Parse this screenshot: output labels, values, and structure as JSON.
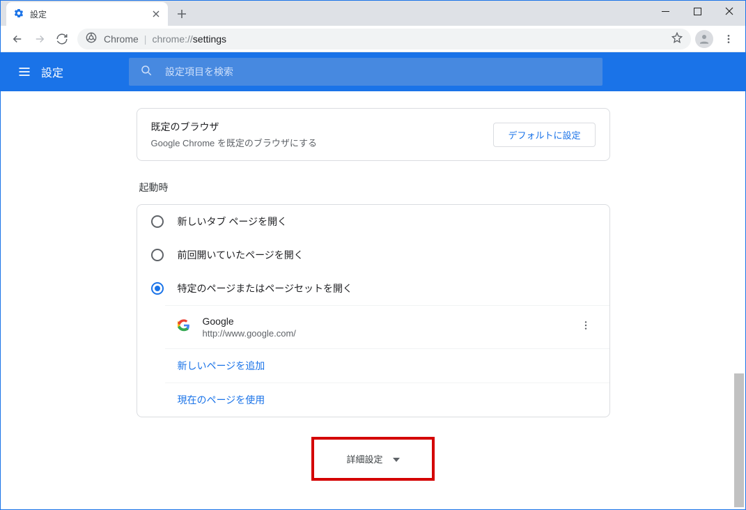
{
  "window": {
    "tab_title": "設定",
    "url_origin": "Chrome",
    "url_path_prefix": "chrome://",
    "url_path": "settings"
  },
  "header": {
    "title": "設定",
    "search_placeholder": "設定項目を検索"
  },
  "default_browser": {
    "title": "既定のブラウザ",
    "subtitle": "Google Chrome を既定のブラウザにする",
    "button": "デフォルトに設定"
  },
  "startup": {
    "heading": "起動時",
    "options": [
      {
        "label": "新しいタブ ページを開く",
        "selected": false
      },
      {
        "label": "前回開いていたページを開く",
        "selected": false
      },
      {
        "label": "特定のページまたはページセットを開く",
        "selected": true
      }
    ],
    "pages": [
      {
        "title": "Google",
        "url": "http://www.google.com/"
      }
    ],
    "add_page": "新しいページを追加",
    "use_current": "現在のページを使用"
  },
  "advanced": {
    "label": "詳細設定"
  }
}
